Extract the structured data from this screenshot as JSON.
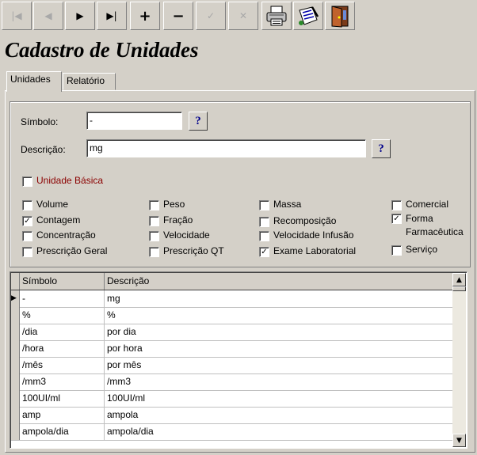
{
  "toolbar": {
    "first": "|◀",
    "prev": "◀",
    "next": "▶",
    "last": "▶|",
    "add": "+",
    "remove": "−",
    "confirm": "✓",
    "cancel": "✕"
  },
  "title": "Cadastro de Unidades",
  "tabs": [
    "Unidades",
    "Relatório"
  ],
  "form": {
    "simbolo_label": "Símbolo:",
    "simbolo_value": "-",
    "descricao_label": "Descrição:",
    "descricao_value": "mg",
    "help": "?",
    "unidade_basica": "Unidade Básica"
  },
  "checkboxes": {
    "volume": "Volume",
    "contagem": "Contagem",
    "concentracao": "Concentração",
    "prescricao_geral": "Prescrição Geral",
    "peso": "Peso",
    "fracao": "Fração",
    "velocidade": "Velocidade",
    "prescricao_qt": "Prescrição QT",
    "massa": "Massa",
    "recomposicao": "Recomposição",
    "velocidade_infusao": "Velocidade Infusão",
    "exame_laboratorial": "Exame Laboratorial",
    "comercial": "Comercial",
    "forma_farmaceutica": "Forma Farmacêutica",
    "servico": "Serviço",
    "check_mark": "✓"
  },
  "grid": {
    "headers": [
      "Símbolo",
      "Descrição"
    ],
    "current_indicator": "▶",
    "rows": [
      [
        "-",
        "mg"
      ],
      [
        "%",
        "%"
      ],
      [
        "/dia",
        "por dia"
      ],
      [
        "/hora",
        "por hora"
      ],
      [
        "/mês",
        "por mês"
      ],
      [
        "/mm3",
        "/mm3"
      ],
      [
        "100UI/ml",
        "100UI/ml"
      ],
      [
        "amp",
        "ampola"
      ],
      [
        "ampola/dia",
        "ampola/dia"
      ]
    ],
    "scroll_up": "▲",
    "scroll_down": "▼"
  }
}
